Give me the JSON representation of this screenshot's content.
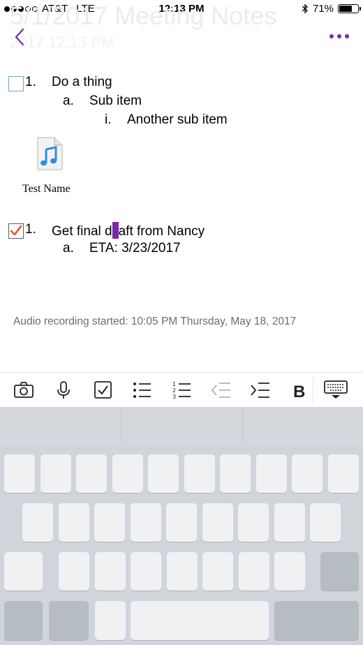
{
  "status_bar": {
    "carrier": "AT&T",
    "network": "LTE",
    "time": "12:13 PM",
    "battery_percent": "71%",
    "battery_level": 0.71
  },
  "background_title": {
    "title": "5/1/2017 Meeting Notes",
    "subtitle": "2017 12:13 PM"
  },
  "nav": {
    "back_icon": "chevron-left-icon",
    "more_icon": "more-dots-icon",
    "accent_color": "#7a27a8"
  },
  "note": {
    "list1": {
      "checked": false,
      "number": "1.",
      "text": "Do a thing",
      "sub": {
        "marker": "a.",
        "text": "Sub item",
        "sub": {
          "marker": "i.",
          "text": "Another sub item"
        }
      }
    },
    "attachment": {
      "icon": "music-file-icon",
      "name": "Test Name"
    },
    "list2": {
      "checked": true,
      "number": "1.",
      "text_before_cursor": "Get final d",
      "text_after_cursor": "aft from Nancy",
      "sub": {
        "marker": "a.",
        "text": "ETA: 3/23/2017"
      }
    },
    "audio_note": "Audio recording started: 10:05 PM Thursday, May 18, 2017"
  },
  "toolbar": {
    "items": [
      {
        "name": "camera-icon"
      },
      {
        "name": "microphone-icon"
      },
      {
        "name": "todo-checkbox-icon"
      },
      {
        "name": "bulleted-list-icon"
      },
      {
        "name": "numbered-list-icon"
      },
      {
        "name": "outdent-icon"
      },
      {
        "name": "indent-icon"
      },
      {
        "name": "bold-icon"
      },
      {
        "name": "dismiss-keyboard-icon"
      }
    ]
  }
}
